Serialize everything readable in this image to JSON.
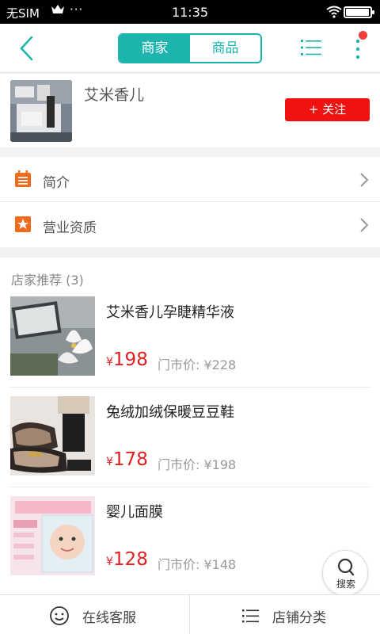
{
  "status_bar": {
    "carrier": "无SIM",
    "time": "11:35",
    "battery_level": 0.95
  },
  "nav": {
    "segments": [
      "商家",
      "商品"
    ],
    "active_segment": "商家",
    "accent_color": "#1cb5ae",
    "icons": [
      "back-icon",
      "list-icon",
      "more-icon"
    ]
  },
  "shop": {
    "name": "艾米香儿",
    "follow_label": "+ 关注",
    "follow_color": "#f01111"
  },
  "menu": [
    {
      "label": "简介",
      "icon": "intro-icon"
    },
    {
      "label": "营业资质",
      "icon": "license-icon"
    }
  ],
  "recommend": {
    "title": "店家推荐 (3)",
    "currency": "¥",
    "items": [
      {
        "name": "艾米香儿孕睫精华液",
        "price": "198",
        "market_price": "门市价: ¥228"
      },
      {
        "name": "兔绒加绒保暖豆豆鞋",
        "price": "178",
        "market_price": "门市价: ¥198"
      },
      {
        "name": "婴儿面膜",
        "price": "128",
        "market_price": "门市价: ¥148"
      }
    ]
  },
  "search_button": {
    "label": "搜索"
  },
  "bottom_bar": {
    "left_label": "在线客服",
    "right_label": "店铺分类"
  }
}
